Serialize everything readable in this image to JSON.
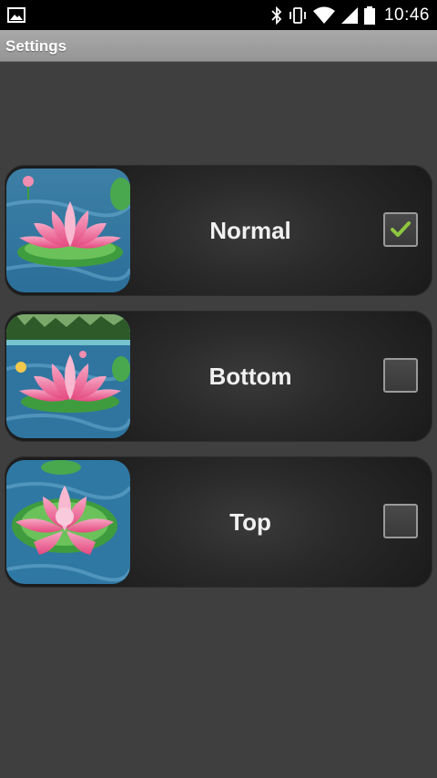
{
  "status_bar": {
    "time": "10:46",
    "icons": [
      "image-notification-icon",
      "bluetooth-icon",
      "vibrate-icon",
      "wifi-icon",
      "cell-signal-icon",
      "battery-icon"
    ]
  },
  "header": {
    "title": "Settings"
  },
  "options": [
    {
      "label": "Normal",
      "checked": true
    },
    {
      "label": "Bottom",
      "checked": false
    },
    {
      "label": "Top",
      "checked": false
    }
  ],
  "colors": {
    "check": "#8dc63f",
    "background": "#3f3f3f",
    "title_bar": "#a0a0a0"
  }
}
